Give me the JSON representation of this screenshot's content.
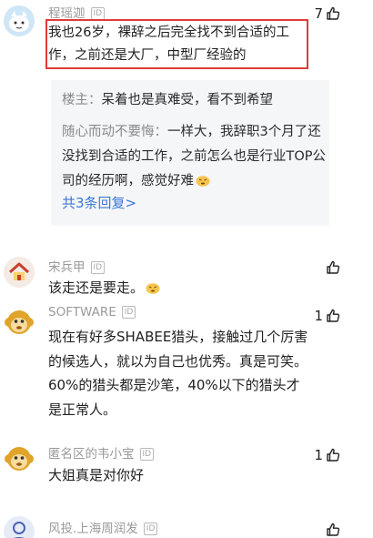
{
  "comments": [
    {
      "username": "程瑶迦",
      "id_badge": "ID",
      "likes": "7",
      "text": "我也26岁，裸辞之后完全找不到合适的工作，之前还是大厂，中型厂经验的",
      "avatar_icon": "cartoon-face-avatar",
      "replies": [
        {
          "author": "楼主：",
          "text": "呆着也是真难受，看不到希望"
        },
        {
          "author": "随心而动不要悔：",
          "text": "一样大，我辞职3个月了还没找到合适的工作，之前怎么也是行业TOP公司的经历啊，感觉好难"
        }
      ],
      "more_replies": "共3条回复>"
    },
    {
      "username": "宋兵甲",
      "id_badge": "ID",
      "likes": "",
      "text": "该走还是要走。",
      "avatar_icon": "house-avatar"
    },
    {
      "username": "SOFTWARE",
      "id_badge": "ID",
      "likes": "1",
      "text": "现在有好多SHABEE猎头，接触过几个厉害的候选人，就以为自己也优秀。真是可笑。60%的猎头都是沙笔，40%以下的猎头才是正常人。",
      "avatar_icon": "monkey-avatar"
    },
    {
      "username": "匿名区的韦小宝",
      "id_badge": "ID",
      "likes": "1",
      "text": "大姐真是对你好",
      "avatar_icon": "monkey-avatar"
    },
    {
      "username": "风投.上海周润发",
      "id_badge": "ID",
      "likes": "",
      "text": "",
      "avatar_icon": "person-avatar"
    }
  ],
  "colors": {
    "highlight_border": "#e03a3a",
    "link": "#3a77d6",
    "reply_bg": "#f5f6f8",
    "username": "#9a9a9a"
  }
}
